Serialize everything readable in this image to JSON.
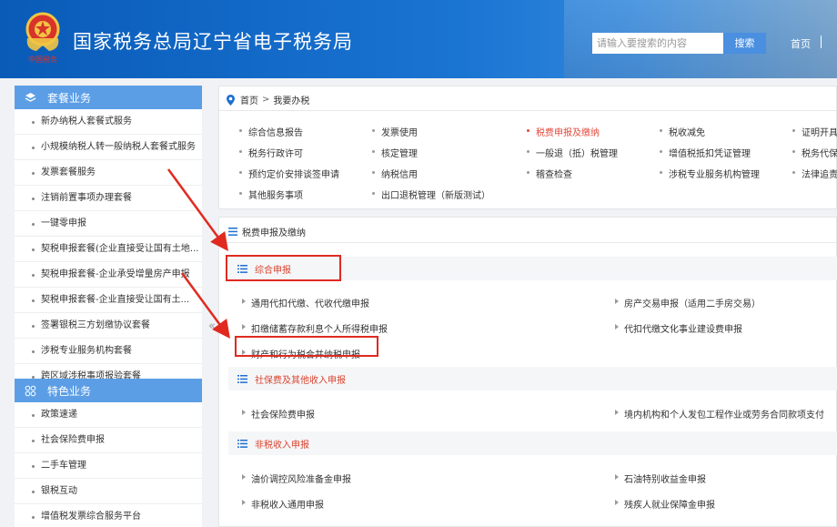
{
  "header": {
    "title": "国家税务总局辽宁省电子税务局",
    "emblem_text": "中国税务",
    "search_placeholder": "请输入要搜索的内容",
    "search_button": "搜索",
    "home_link": "首页"
  },
  "sidebar": {
    "package_section": {
      "title": "套餐业务",
      "items": [
        "新办纳税人套餐式服务",
        "小规模纳税人转一般纳税人套餐式服务",
        "发票套餐服务",
        "注销前置事项办理套餐",
        "一键零申报",
        "契税申报套餐(企业直接受让国有土地...",
        "契税申报套餐-企业承受增量房产申报",
        "契税申报套餐-企业直接受让国有土...",
        "签署银税三方划缴协议套餐",
        "涉税专业服务机构套餐",
        "跨区域涉税事项报验套餐"
      ]
    },
    "feature_section": {
      "title": "特色业务",
      "items": [
        "政策速递",
        "社会保险费申报",
        "二手车管理",
        "银税互动",
        "增值税发票综合服务平台"
      ]
    },
    "collapse_glyph": "«"
  },
  "breadcrumb": {
    "home": "首页",
    "separator": ">",
    "current": "我要办税"
  },
  "categories": [
    {
      "label": "综合信息报告",
      "active": false
    },
    {
      "label": "发票使用",
      "active": false
    },
    {
      "label": "税费申报及缴纳",
      "active": true
    },
    {
      "label": "税收减免",
      "active": false
    },
    {
      "label": "证明开具",
      "active": false
    },
    {
      "label": "税务行政许可",
      "active": false
    },
    {
      "label": "核定管理",
      "active": false
    },
    {
      "label": "一般退（抵）税管理",
      "active": false
    },
    {
      "label": "增值税抵扣凭证管理",
      "active": false
    },
    {
      "label": "税务代保管",
      "active": false
    },
    {
      "label": "预约定价安排谈签申请",
      "active": false
    },
    {
      "label": "纳税信用",
      "active": false
    },
    {
      "label": "稽查检查",
      "active": false
    },
    {
      "label": "涉税专业服务机构管理",
      "active": false
    },
    {
      "label": "法律追责与",
      "active": false
    },
    {
      "label": "其他服务事项",
      "active": false
    },
    {
      "label": "出口退税管理（新版测试）",
      "active": false
    }
  ],
  "content": {
    "title": "税费申报及缴纳",
    "sections": [
      {
        "title": "综合申报",
        "links": [
          "通用代扣代缴、代收代缴申报",
          "房产交易申报（适用二手房交易）",
          "扣缴储蓄存款利息个人所得税申报",
          "代扣代缴文化事业建设费申报",
          "财产和行为税合并纳税申报"
        ]
      },
      {
        "title": "社保费及其他收入申报",
        "links": [
          "社会保险费申报",
          "境内机构和个人发包工程作业或劳务合同款项支付"
        ]
      },
      {
        "title": "非税收入申报",
        "links": [
          "油价调控风险准备金申报",
          "石油特别收益金申报",
          "非税收入通用申报",
          "残疾人就业保障金申报"
        ]
      }
    ]
  },
  "colors": {
    "header_blue": "#0a5bb8",
    "sidebar_head": "#5b9ee6",
    "accent_red": "#e24a3b",
    "highlight_red": "#e02a20",
    "search_button": "#4a8fe0"
  }
}
